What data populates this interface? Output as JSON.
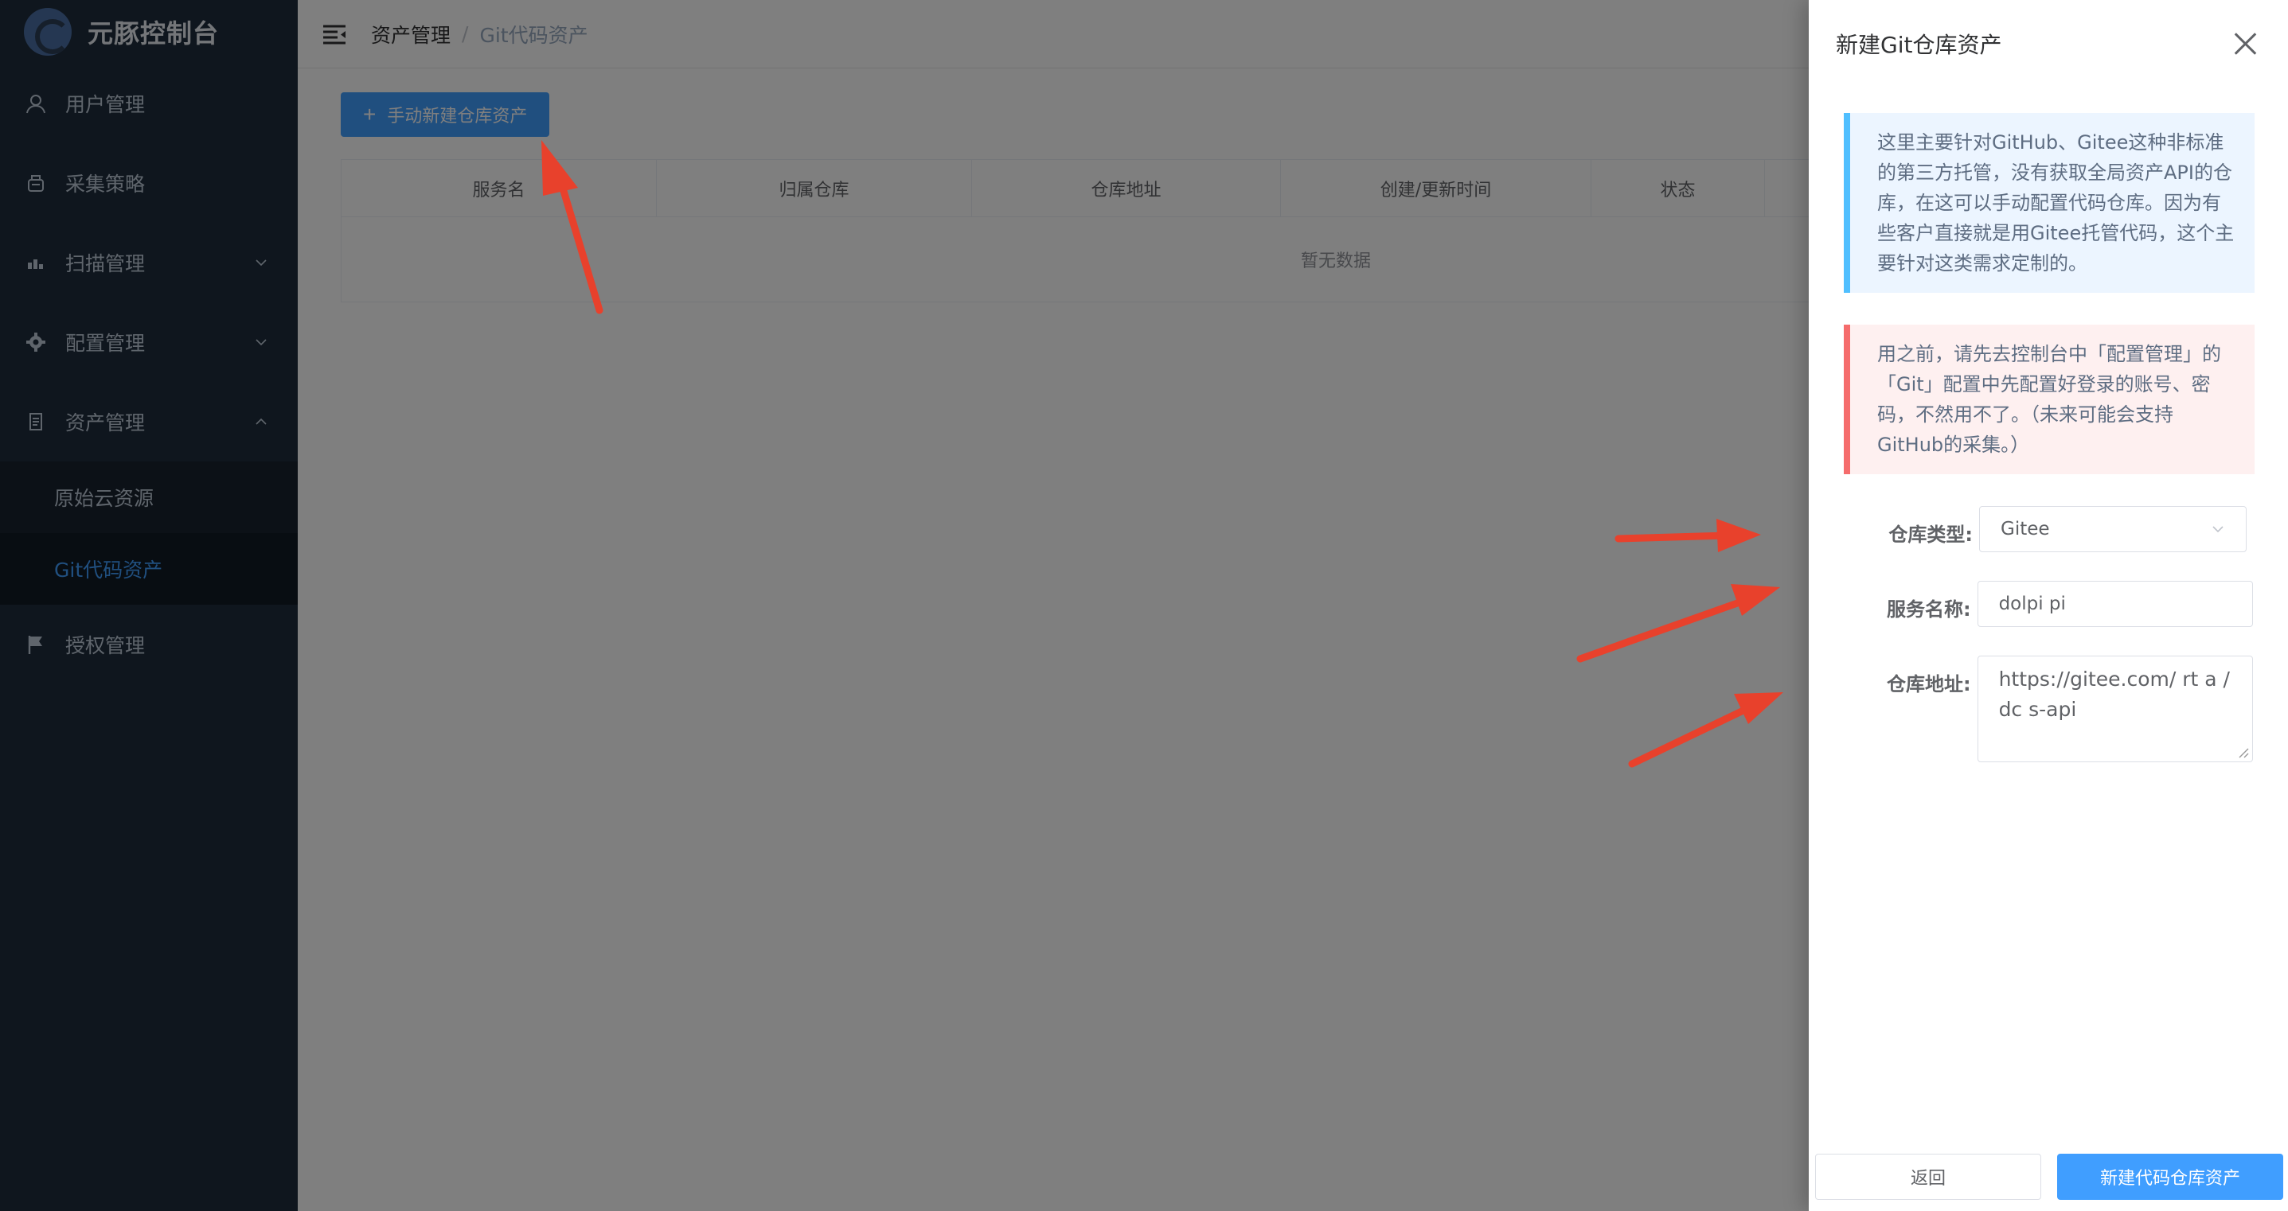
{
  "sidebar": {
    "brand_title": "元豚控制台",
    "menu": [
      {
        "label": "用户管理",
        "icon": "user-icon"
      },
      {
        "label": "采集策略",
        "icon": "strategy-icon"
      },
      {
        "label": "扫描管理",
        "icon": "scan-icon"
      },
      {
        "label": "配置管理",
        "icon": "gear-icon"
      },
      {
        "label": "资产管理",
        "icon": "document-icon"
      }
    ],
    "submenu": [
      {
        "label": "原始云资源"
      },
      {
        "label": "Git代码资产"
      }
    ],
    "auth_label": "授权管理"
  },
  "navbar": {
    "breadcrumb": [
      "资产管理",
      "Git代码资产"
    ],
    "separator": "/"
  },
  "main": {
    "add_button_label": "手动新建仓库资产",
    "table": {
      "columns": [
        "服务名",
        "归属仓库",
        "仓库地址",
        "创建/更新时间",
        "状态"
      ],
      "empty_text": "暂无数据"
    }
  },
  "drawer": {
    "title": "新建Git仓库资产",
    "info_text": "这里主要针对GitHub、Gitee这种非标准的第三方托管，没有获取全局资产API的仓库，在这可以手动配置代码仓库。因为有些客户直接就是用Gitee托管代码，这个主要针对这类需求定制的。",
    "warning_text": "用之前，请先去控制台中「配置管理」的「Git」配置中先配置好登录的账号、密码，不然用不了。（未来可能会支持GitHub的采集。）",
    "form": {
      "repo_type_label": "仓库类型:",
      "repo_type_value": "Gitee",
      "service_name_label": "服务名称:",
      "service_name_value": "dolpi pi",
      "repo_url_label": "仓库地址:",
      "repo_url_value": "https://gitee.com/ rt a /dc s-api"
    },
    "cancel_label": "返回",
    "submit_label": "新建代码仓库资产"
  },
  "colors": {
    "sidebar_bg": "#1f2d3d",
    "primary": "#409eff",
    "annotation_arrow": "#e8412c"
  }
}
